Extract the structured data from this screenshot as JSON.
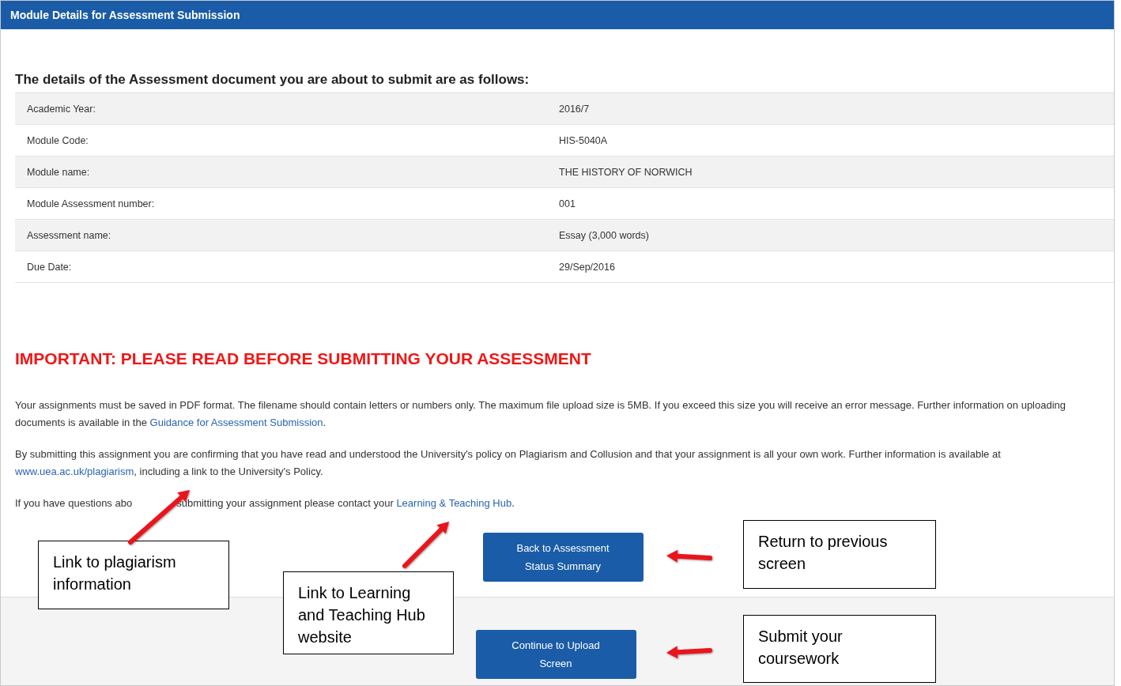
{
  "panel": {
    "title": "Module Details for Assessment Submission"
  },
  "details": {
    "heading": "The details of the Assessment document you are about to submit are as follows:",
    "rows": [
      {
        "label": "Academic Year:",
        "value": "2016/7"
      },
      {
        "label": "Module Code:",
        "value": "HIS-5040A"
      },
      {
        "label": "Module name:",
        "value": "THE HISTORY OF NORWICH"
      },
      {
        "label": "Module Assessment number:",
        "value": "001"
      },
      {
        "label": "Assessment name:",
        "value": "Essay (3,000 words)"
      },
      {
        "label": "Due Date:",
        "value": "29/Sep/2016"
      }
    ]
  },
  "notice": {
    "heading": "IMPORTANT: PLEASE READ BEFORE SUBMITTING YOUR ASSESSMENT",
    "paragraphs": [
      {
        "parts": [
          {
            "kind": "text",
            "text": "Your assignments must be saved in PDF format. The filename should contain letters or numbers only. The maximum file upload size is 5MB. If you exceed this size you will receive an error message. Further information on uploading documents is available in the "
          },
          {
            "kind": "link",
            "text": "Guidance for Assessment Submission"
          },
          {
            "kind": "text",
            "text": "."
          }
        ]
      },
      {
        "parts": [
          {
            "kind": "text",
            "text": "By submitting this assignment you are confirming that you have read and understood the University's policy on Plagiarism and Collusion and that your assignment is all your own work. Further information is available at "
          },
          {
            "kind": "link",
            "text": "www.uea.ac.uk/plagiarism"
          },
          {
            "kind": "text",
            "text": ", including a link to the University's Policy."
          }
        ]
      },
      {
        "parts": [
          {
            "kind": "text",
            "text": "If you have questions abo"
          },
          {
            "kind": "covered"
          },
          {
            "kind": "text",
            "text": "submitting your assignment please contact your "
          },
          {
            "kind": "link",
            "text": "Learning & Teaching Hub"
          },
          {
            "kind": "text",
            "text": "."
          }
        ]
      }
    ]
  },
  "buttons": [
    {
      "label": "Back to Assessment Status Summary"
    },
    {
      "label": "Continue to Upload Screen"
    }
  ],
  "callouts": [
    {
      "text": "Link to plagiarism information"
    },
    {
      "text": "Link to Learning and Teaching Hub website"
    },
    {
      "text": "Return to previous screen"
    },
    {
      "text": "Submit your coursework"
    }
  ]
}
